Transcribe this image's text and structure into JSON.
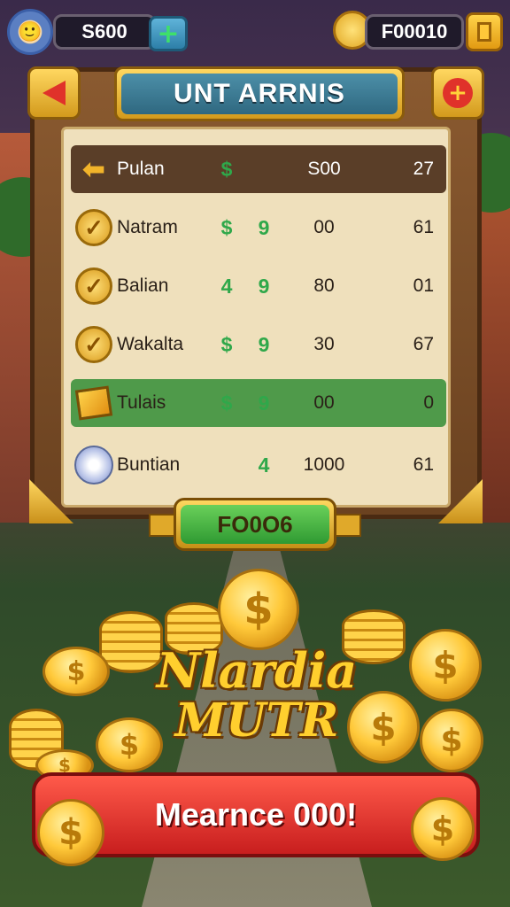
{
  "topbar": {
    "left_value": "S600",
    "plus_label": "+",
    "right_value": "F00010"
  },
  "board": {
    "title": "UNT ARRNIS",
    "close_label": "+"
  },
  "rows": [
    {
      "name": "Pulan",
      "c1": "$",
      "c2": "",
      "c3": "S00",
      "c4": "27",
      "icon": "back-arrow-icon"
    },
    {
      "name": "Natram",
      "c1": "$",
      "c2": "9",
      "c3": "00",
      "c4": "61",
      "icon": "checkmark-coin-icon"
    },
    {
      "name": "Balian",
      "c1": "4",
      "c2": "9",
      "c3": "80",
      "c4": "01",
      "icon": "checkmark-coin-icon"
    },
    {
      "name": "Wakalta",
      "c1": "$",
      "c2": "9",
      "c3": "30",
      "c4": "67",
      "icon": "checkmark-coin-icon"
    },
    {
      "name": "Tulais",
      "c1": "$",
      "c2": "9",
      "c3": "00",
      "c4": "0",
      "icon": "gold-cube-icon"
    },
    {
      "name": "Buntian",
      "c1": "",
      "c2": "4",
      "c3": "1000",
      "c4": "61",
      "icon": "silver-orb-icon"
    }
  ],
  "tab_button": "FO0O6",
  "logo": {
    "line1": "Nlardia",
    "line2": "MUTR"
  },
  "cta": "Mearnce 000!",
  "coin_symbol": "$"
}
